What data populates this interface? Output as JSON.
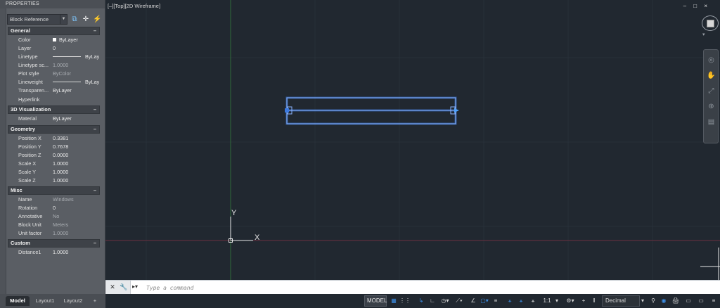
{
  "properties": {
    "title": "PROPERTIES",
    "selection": "Block Reference",
    "sections": {
      "general": "General",
      "viz3d": "3D Visualization",
      "geometry": "Geometry",
      "misc": "Misc",
      "custom": "Custom"
    },
    "collapse_glyph": "–",
    "rows": {
      "color": {
        "k": "Color",
        "v": "ByLayer"
      },
      "layer": {
        "k": "Layer",
        "v": "0"
      },
      "linetype": {
        "k": "Linetype",
        "v": "ByLayer"
      },
      "linetype_scale": {
        "k": "Linetype sc...",
        "v": "1.0000"
      },
      "plot_style": {
        "k": "Plot style",
        "v": "ByColor"
      },
      "lineweight": {
        "k": "Lineweight",
        "v": "ByLayer"
      },
      "transparency": {
        "k": "Transparen...",
        "v": "ByLayer"
      },
      "hyperlink": {
        "k": "Hyperlink",
        "v": ""
      },
      "material": {
        "k": "Material",
        "v": "ByLayer"
      },
      "pos_x": {
        "k": "Position X",
        "v": "0.3381"
      },
      "pos_y": {
        "k": "Position Y",
        "v": "0.7678"
      },
      "pos_z": {
        "k": "Position Z",
        "v": "0.0000"
      },
      "scale_x": {
        "k": "Scale X",
        "v": "1.0000"
      },
      "scale_y": {
        "k": "Scale Y",
        "v": "1.0000"
      },
      "scale_z": {
        "k": "Scale Z",
        "v": "1.0000"
      },
      "name": {
        "k": "Name",
        "v": "Windows"
      },
      "rotation": {
        "k": "Rotation",
        "v": "0"
      },
      "annotative": {
        "k": "Annotative",
        "v": "No"
      },
      "block_unit": {
        "k": "Block Unit",
        "v": "Meters"
      },
      "unit_factor": {
        "k": "Unit factor",
        "v": "1.0000"
      },
      "distance1": {
        "k": "Distance1",
        "v": "1.0000"
      }
    }
  },
  "layout_tabs": {
    "model": "Model",
    "layout1": "Layout1",
    "layout2": "Layout2",
    "add": "+"
  },
  "viewport": {
    "label": "[–][Top][2D Wireframe]",
    "win_controls": "– □ ×",
    "ucs_y": "Y",
    "ucs_x": "X"
  },
  "command": {
    "placeholder": "Type a command"
  },
  "status": {
    "model": "MODEL",
    "scale": "1:1",
    "units": "Decimal"
  },
  "colors": {
    "background": "#212830",
    "selection_blue": "#3a78e0",
    "palette": "#5a5e64"
  }
}
